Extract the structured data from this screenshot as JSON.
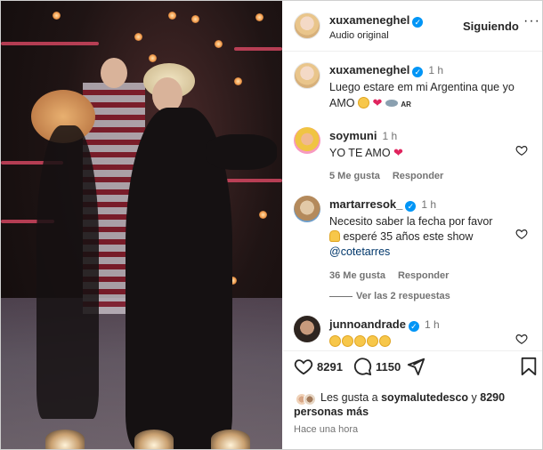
{
  "post": {
    "author": "xuxameneghel",
    "audio": "Audio original",
    "follow_label": "Siguiendo"
  },
  "caption": {
    "username": "xuxameneghel",
    "time": "1 h",
    "text_line1": "Luego estare em mi Argentina que yo",
    "text_line2": "AMO",
    "flag_label": "AR"
  },
  "comments": [
    {
      "username": "soymuni",
      "time": "1 h",
      "text": "YO TE AMO",
      "likes": "5 Me gusta",
      "reply": "Responder"
    },
    {
      "username": "martarresok_",
      "time": "1 h",
      "text_line1": "Necesito saber la fecha por favor",
      "text_line2": "esperé 35 años este show",
      "mention": "@cotetarres",
      "likes": "36 Me gusta",
      "reply": "Responder",
      "view_replies": "Ver las 2 respuestas"
    },
    {
      "username": "junnoandrade",
      "time": "1 h"
    }
  ],
  "actions": {
    "likes_count": "8291",
    "comments_count": "1150"
  },
  "liked_by": {
    "prefix": "Les gusta a ",
    "user": "soymalutedesco",
    "middle": " y ",
    "others": "8290",
    "line2": "personas más"
  },
  "posted": "Hace una hora",
  "icons": {
    "like": "heart-icon",
    "comment": "comment-icon",
    "share": "paper-plane-icon",
    "save": "bookmark-icon",
    "more": "more-icon",
    "verified": "verified-badge-icon"
  },
  "colors": {
    "accent": "#0095f6",
    "text": "#262626",
    "muted": "#737373",
    "heart": "#e0245e"
  }
}
